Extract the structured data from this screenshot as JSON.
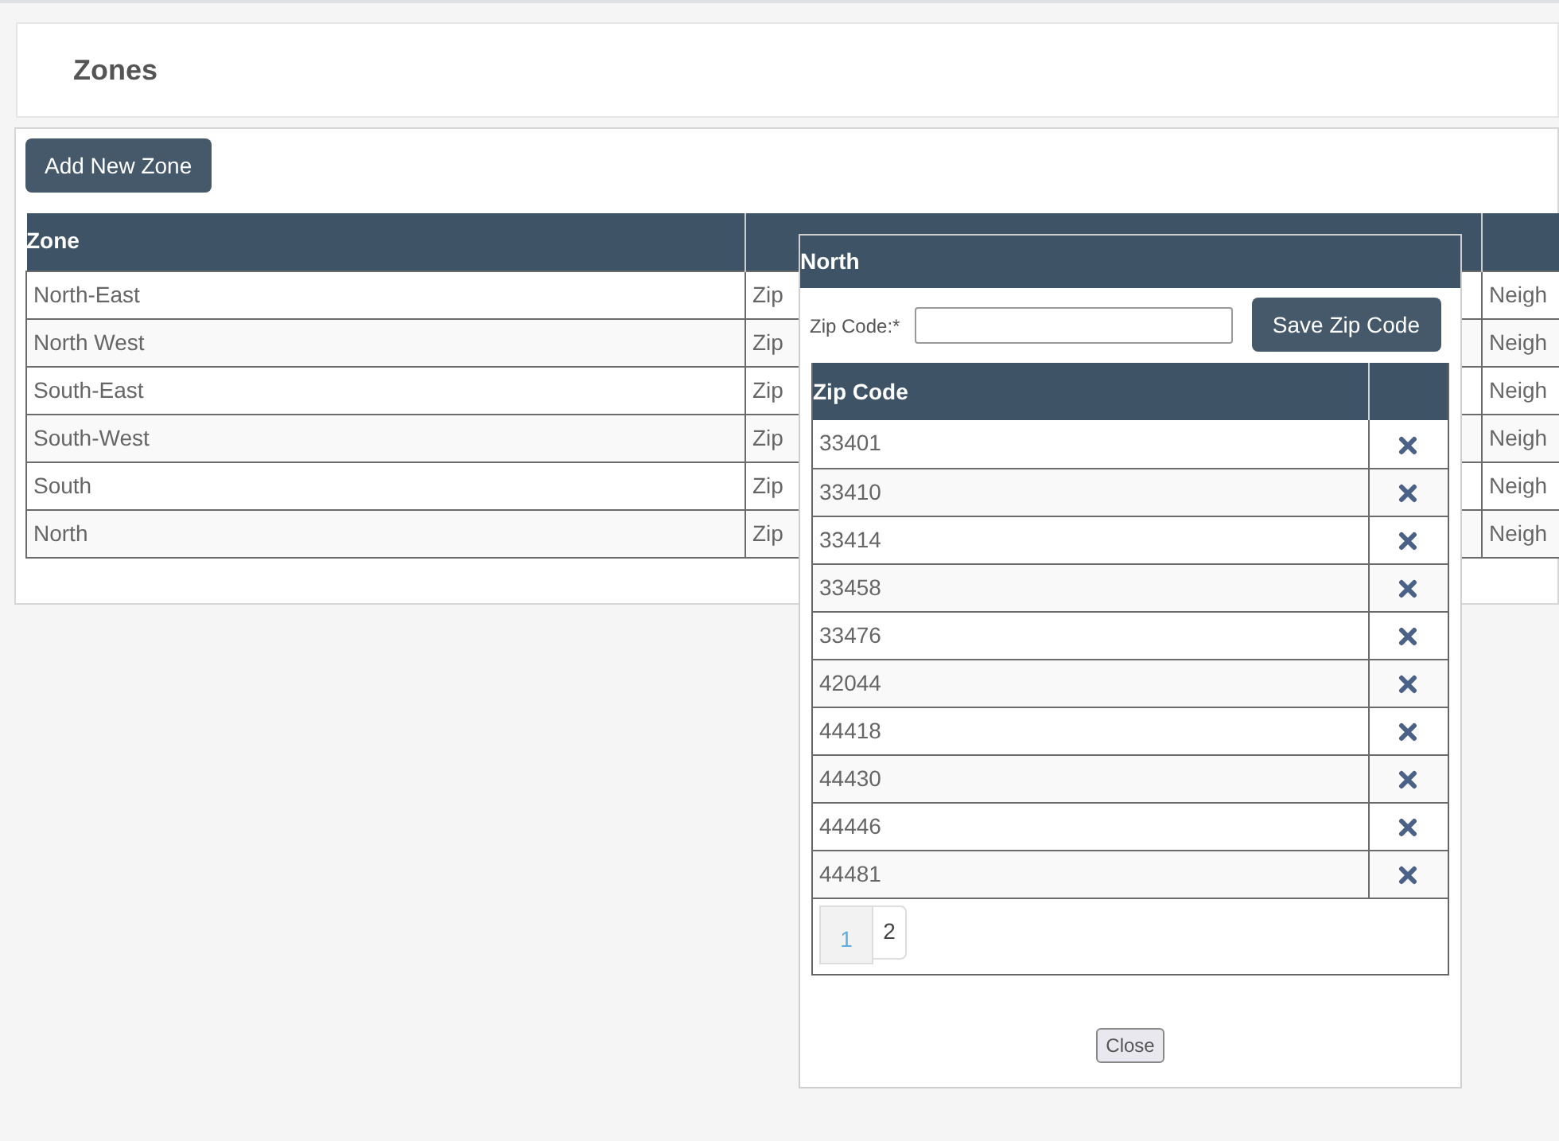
{
  "page": {
    "title": "Zones"
  },
  "add_button": "Add New Zone",
  "zones_table": {
    "columns": [
      "Zone"
    ],
    "rows": [
      {
        "zone": "North-East",
        "column_2": "Zip",
        "column_3": "Neigh"
      },
      {
        "zone": "North West",
        "column_2": "Zip",
        "column_3": "Neigh"
      },
      {
        "zone": "South-East",
        "column_2": "Zip",
        "column_3": "Neigh"
      },
      {
        "zone": "South-West",
        "column_2": "Zip",
        "column_3": "Neigh"
      },
      {
        "zone": "South",
        "column_2": "Zip",
        "column_3": "Neigh"
      },
      {
        "zone": "North",
        "column_2": "Zip",
        "column_3": "Neigh"
      }
    ]
  },
  "dialog": {
    "title": "North",
    "field_label": "Zip Code:*",
    "save_button": "Save Zip Code",
    "columns": [
      "Zip Code"
    ],
    "rows": [
      "33401",
      "33410",
      "33414",
      "33458",
      "33476",
      "42044",
      "44418",
      "44430",
      "44446",
      "44481"
    ],
    "pages": [
      {
        "label": "1",
        "selected": true
      },
      {
        "label": "2",
        "selected": false
      }
    ],
    "close_button": "Close"
  }
}
